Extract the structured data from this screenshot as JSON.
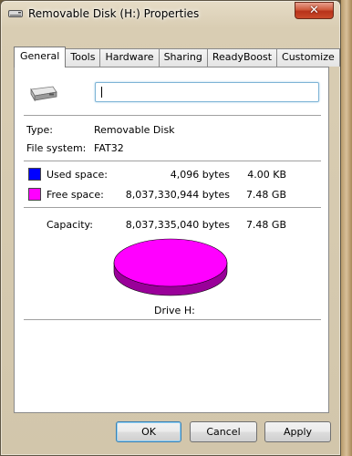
{
  "window": {
    "title": "Removable Disk (H:) Properties",
    "close_label": "✕"
  },
  "tabs": [
    {
      "label": "General",
      "active": true
    },
    {
      "label": "Tools",
      "active": false
    },
    {
      "label": "Hardware",
      "active": false
    },
    {
      "label": "Sharing",
      "active": false
    },
    {
      "label": "ReadyBoost",
      "active": false
    },
    {
      "label": "Customize",
      "active": false
    }
  ],
  "general": {
    "volume_name_value": "",
    "type_label": "Type:",
    "type_value": "Removable Disk",
    "fs_label": "File system:",
    "fs_value": "FAT32",
    "used": {
      "label": "Used space:",
      "bytes": "4,096 bytes",
      "size": "4.00 KB",
      "color": "#0000ff"
    },
    "free": {
      "label": "Free space:",
      "bytes": "8,037,330,944 bytes",
      "size": "7.48 GB",
      "color": "#ff00ff"
    },
    "capacity": {
      "label": "Capacity:",
      "bytes": "8,037,335,040 bytes",
      "size": "7.48 GB"
    },
    "drive_label": "Drive H:"
  },
  "buttons": {
    "ok": "OK",
    "cancel": "Cancel",
    "apply": "Apply"
  }
}
